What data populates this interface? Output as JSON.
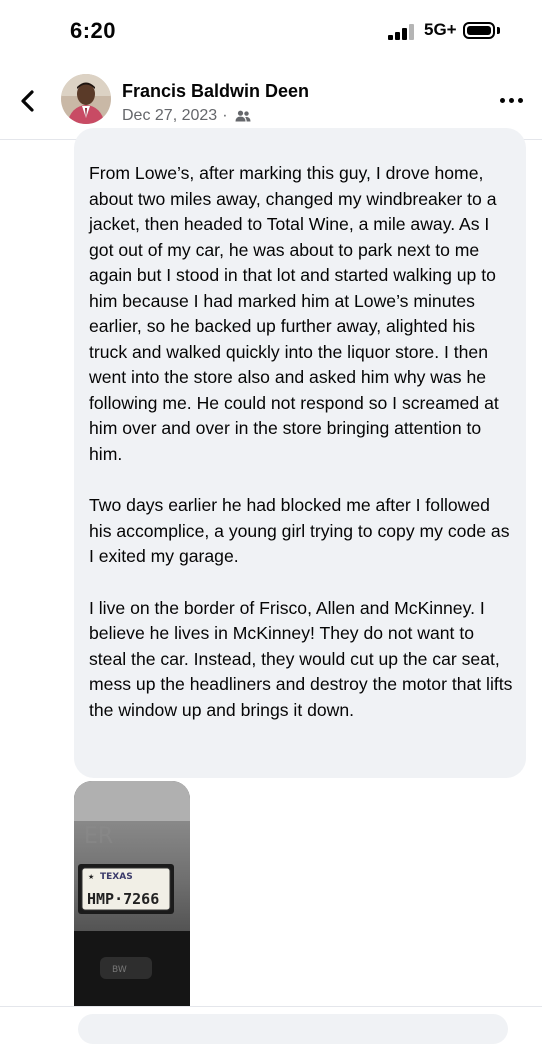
{
  "status_bar": {
    "time": "6:20",
    "network": "5G+",
    "signal_bars_active": 3,
    "signal_bars_total": 4,
    "battery_level": 0.9
  },
  "header": {
    "back_icon": "chevron-left-icon",
    "poster_name": "Francis Baldwin Deen",
    "date": "Dec 27, 2023",
    "separator": "·",
    "audience_icon": "friends-icon",
    "more_icon": "more-horizontal-icon"
  },
  "message": {
    "paragraphs": [
      "From Lowe’s, after marking this guy, I drove home, about two miles away, changed my windbreaker to a jacket, then headed to Total Wine, a mile away.  As I got out of my car, he was about to park next to me  again but I stood in that lot and started walking up to him because I had marked him at Lowe’s minutes earlier, so he backed up further away, alighted his truck and walked quickly into the liquor store. I then went into the store also and asked him why was he following me. He could not respond so I screamed at him over and over in the store bringing attention to him.",
      "Two days earlier he had blocked me after I followed his accomplice, a young girl trying to copy my code as I exited my garage.",
      "I live on the border of Frisco, Allen and McKinney. I believe he lives in McKinney! They do not want to steal the car. Instead, they would cut up the car seat, mess up the headliners and destroy the motor that lifts the window up and brings it down."
    ]
  },
  "photo": {
    "plate_state": "TEXAS",
    "plate_number": "HMP·7266"
  },
  "colors": {
    "bubble_bg": "#f0f2f5",
    "meta_text": "#65676b",
    "divider": "#e4e6eb"
  }
}
